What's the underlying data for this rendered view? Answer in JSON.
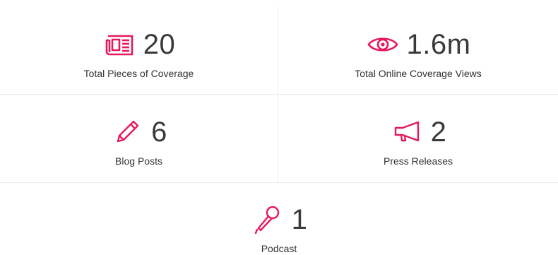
{
  "accent_color": "#e5195f",
  "stats": [
    {
      "icon": "newspaper-icon",
      "value": "20",
      "label": "Total Pieces of Coverage"
    },
    {
      "icon": "eye-icon",
      "value": "1.6m",
      "label": "Total Online Coverage Views"
    },
    {
      "icon": "pencil-icon",
      "value": "6",
      "label": "Blog Posts"
    },
    {
      "icon": "megaphone-icon",
      "value": "2",
      "label": "Press Releases"
    },
    {
      "icon": "microphone-icon",
      "value": "1",
      "label": "Podcast"
    }
  ]
}
